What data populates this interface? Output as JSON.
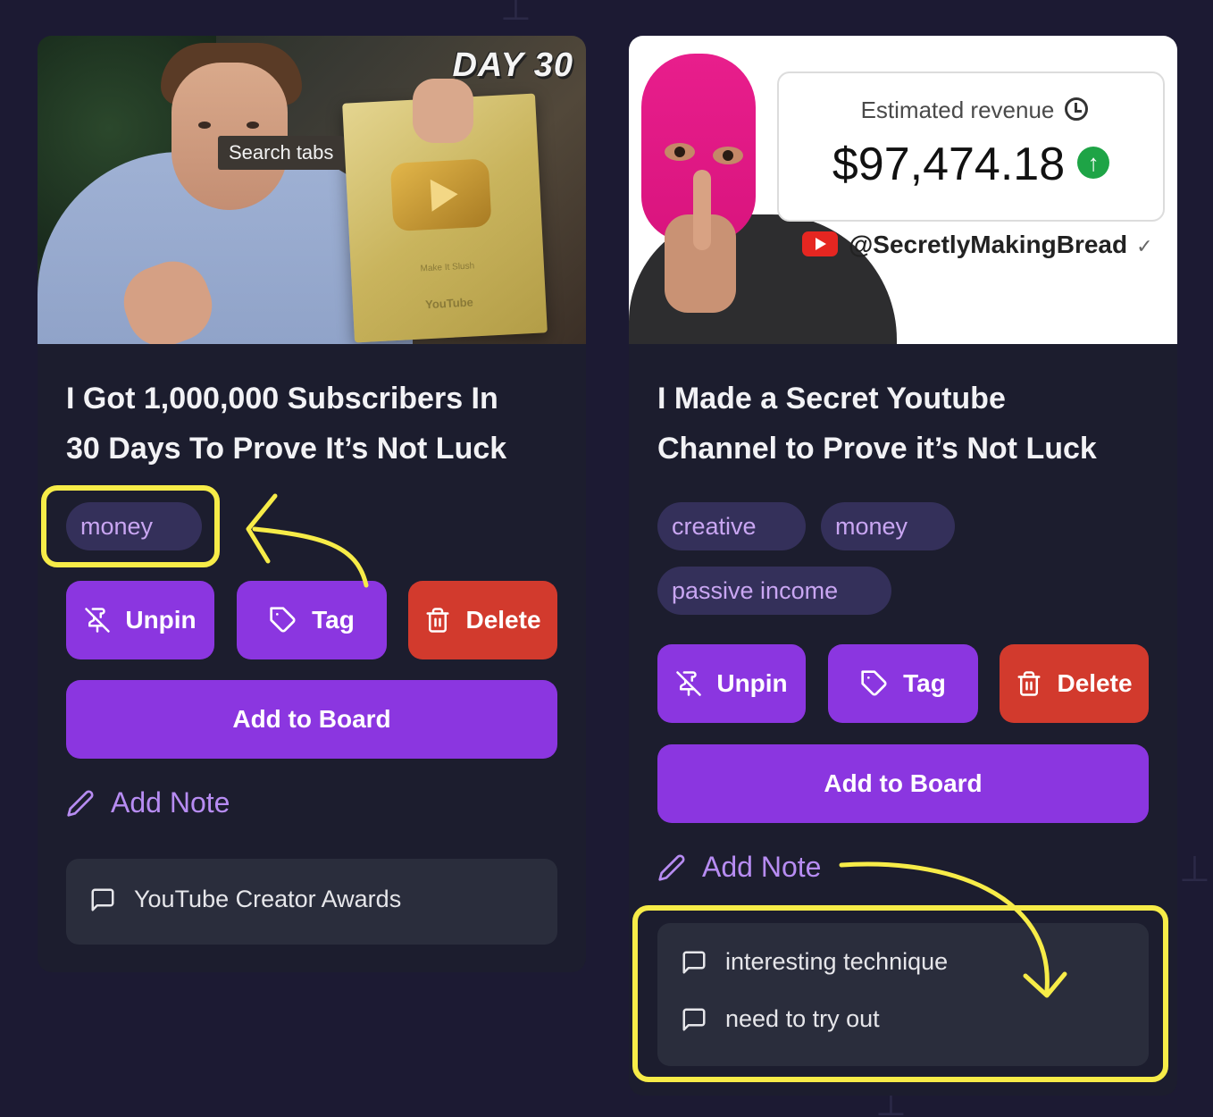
{
  "cards": [
    {
      "title_line1": "I Got 1,000,000 Subscribers In",
      "title_line2": "30 Days To Prove It’s Not Luck",
      "thumbnail": {
        "overlay_text": "DAY 30",
        "plaque_line1": "Make It Slush",
        "plaque_brand": "YouTube"
      },
      "tooltip": "Search tabs",
      "tags": [
        "money"
      ],
      "buttons": {
        "unpin": "Unpin",
        "tag": "Tag",
        "delete": "Delete",
        "add_to_board": "Add to Board"
      },
      "add_note": "Add Note",
      "notes": [
        "YouTube Creator Awards"
      ]
    },
    {
      "title_line1": "I Made a Secret Youtube",
      "title_line2": "Channel to Prove it’s Not Luck",
      "thumbnail": {
        "revenue_label": "Estimated revenue",
        "revenue_amount": "$97,474.18",
        "channel": "@SecretlyMakingBread",
        "channel_check": "✓"
      },
      "tags": [
        "creative",
        "money",
        "passive income"
      ],
      "buttons": {
        "unpin": "Unpin",
        "tag": "Tag",
        "delete": "Delete",
        "add_to_board": "Add to Board"
      },
      "add_note": "Add Note",
      "notes": [
        "interesting technique",
        "need to try out"
      ]
    }
  ],
  "colors": {
    "background": "#1c1a33",
    "card": "#1c1d2e",
    "accent_purple": "#8b36e0",
    "delete_red": "#d23a2d",
    "tag_bg": "#34305a",
    "tag_text": "#c9a6f2",
    "add_note_text": "#b78cf2",
    "note_bg": "#2a2d3c",
    "annotation_yellow": "#f7ec48"
  },
  "icons": {
    "unpin": "pin-off-icon",
    "tag": "tag-icon",
    "delete": "trash-icon",
    "add_note": "pencil-icon",
    "note": "message-square-icon",
    "clock": "clock-icon",
    "revenue_up": "arrow-up-circle-icon"
  }
}
